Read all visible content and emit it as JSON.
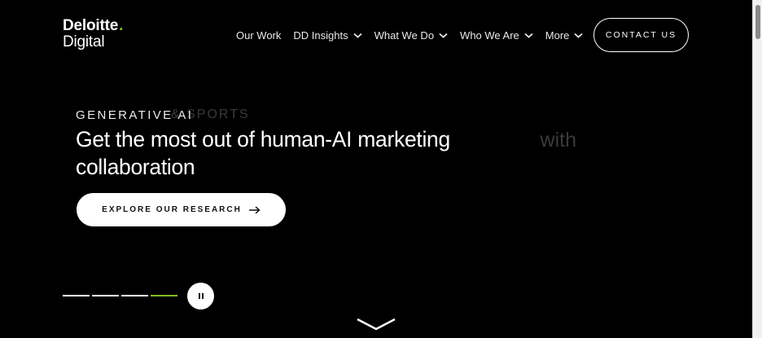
{
  "logo": {
    "brand": "Deloitte",
    "dot": ".",
    "sub": "Digital"
  },
  "nav": {
    "items": [
      {
        "label": "Our Work",
        "has_dropdown": false
      },
      {
        "label": "DD Insights",
        "has_dropdown": true
      },
      {
        "label": "What We Do",
        "has_dropdown": true
      },
      {
        "label": "Who We Are",
        "has_dropdown": true
      },
      {
        "label": "More",
        "has_dropdown": true
      }
    ],
    "contact_label": "CONTACT US"
  },
  "hero": {
    "eyebrow": "GENERATIVE AI",
    "headline": "Get the most out of human-AI marketing collaboration",
    "cta_label": "EXPLORE OUR RESEARCH"
  },
  "carousel": {
    "slide_count": 4,
    "active_index": 3,
    "pause_label": "II"
  },
  "colors": {
    "accent": "#86bc25",
    "background": "#000000"
  }
}
